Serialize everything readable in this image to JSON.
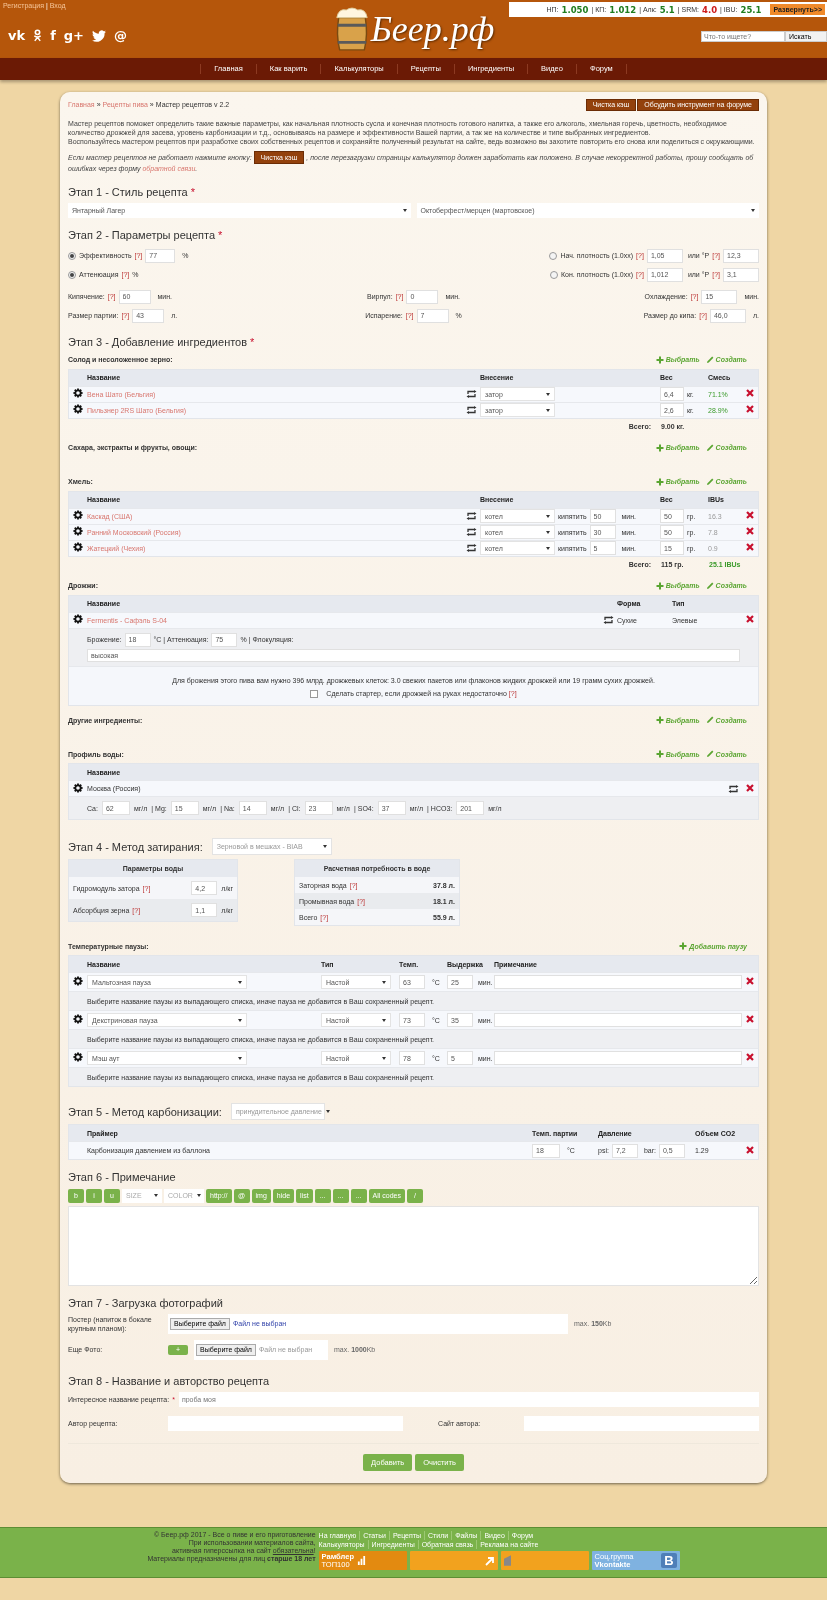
{
  "header": {
    "auth_links": [
      {
        "label": "Регистрация",
        "separator": "|"
      },
      {
        "label": "Вход"
      }
    ],
    "social": [
      {
        "kind": "text",
        "glyph": "vk"
      },
      {
        "kind": "ok"
      },
      {
        "kind": "text",
        "glyph": "f"
      },
      {
        "kind": "text",
        "glyph": "g+"
      },
      {
        "kind": "twitter"
      },
      {
        "kind": "text",
        "glyph": "@"
      }
    ],
    "logo": "Беер.рф",
    "stats": [
      {
        "label": "НП:",
        "value": "1.050",
        "color": "#1e7d1e"
      },
      {
        "label": "| КП:",
        "value": "1.012",
        "color": "#1e7d1e"
      },
      {
        "label": "| Алк:",
        "value": "5.1",
        "color": "#1e7d1e"
      },
      {
        "label": "| SRM:",
        "value": "4.0",
        "color": "#cc1a1a"
      },
      {
        "label": "| IBU:",
        "value": "25.1",
        "color": "#1e7d1e"
      }
    ],
    "expand_button": "Развернуть>>",
    "search": {
      "placeholder": "Что-то ищете?",
      "button": "Искать"
    }
  },
  "nav": [
    "Главная",
    "Как варить",
    "Калькуляторы",
    "Рецепты",
    "Ингредиенты",
    "Видео",
    "Форум"
  ],
  "breadcrumbs": [
    {
      "label": "Главная",
      "separator": "»"
    },
    {
      "label": "Рецепты пива",
      "separator": "»"
    },
    {
      "label": "Мастер рецептов v 2.2"
    }
  ],
  "top_buttons": [
    "Чистка кэш",
    "Обсудить инструмент на форуме"
  ],
  "intro": [
    "Мастер рецептов поможет определить такие важные параметры, как начальная плотность сусла и конечная плотность готового напитка, а также его алкоголь, хмельная горечь, цветность, необходимое количество дрожжей для засева, уровень карбонизации и т.д., основываясь на размере и эффективности Вашей партии, а так же на количестве и типе выбранных ингредиентов.",
    "Воспользуйтесь мастером рецептов при разработке своих собственных рецептов и сохраняйте полученный результат на сайте, ведь возможно вы захотите повторить его снова или поделиться с окружающими."
  ],
  "note": {
    "before": "Если мастер рецептов не работает нажмите кнопку:",
    "button": "Чистка кэш",
    "after": ", после перезагрузки страницы калькулятор должен заработать как положено. В случае некорректной работы, прошу сообщать об ошибках через форму",
    "link": "обратной связи",
    "end": "."
  },
  "stage1": {
    "title": "Этап 1 - Стиль рецепта",
    "required": "*",
    "selects": [
      "Янтарный Лагер",
      "Октоберфест/мерцен (мартовское)"
    ]
  },
  "stage2": {
    "title": "Этап 2 - Параметры рецепта",
    "required": "*",
    "radio_rows": [
      {
        "left": {
          "selected": true,
          "label": "Эффективность",
          "help": "[?]",
          "value": "77",
          "unit": "%"
        },
        "right": {
          "selected": false,
          "label": "Нач. плотность (1.0xx)",
          "help": "[?]",
          "value": "1,05",
          "alt_label": "или °P",
          "alt_help": "[?]",
          "alt_value": "12,3"
        }
      },
      {
        "left": {
          "selected": true,
          "label": "Аттенюация",
          "help": "[?]",
          "unit": "%"
        },
        "right": {
          "selected": false,
          "label": "Кон. плотность (1.0xx)",
          "help": "[?]",
          "value": "1,012",
          "alt_label": "или °P",
          "alt_help": "[?]",
          "alt_value": "3,1"
        }
      }
    ],
    "param_rows": [
      [
        {
          "label": "Кипячение:",
          "help": "[?]",
          "value": "60",
          "unit": "мин."
        },
        {
          "label": "Вирпул:",
          "help": "[?]",
          "value": "0",
          "unit": "мин."
        },
        {
          "label": "Охлаждение:",
          "help": "[?]",
          "value": "15",
          "unit": "мин."
        }
      ],
      [
        {
          "label": "Размер партии:",
          "help": "[?]",
          "value": "43",
          "unit": "л."
        },
        {
          "label": "Испарение:",
          "help": "[?]",
          "value": "7",
          "unit": "%"
        },
        {
          "label": "Размер до кипа:",
          "help": "[?]",
          "value": "46,0",
          "unit": "л."
        }
      ]
    ]
  },
  "stage3": {
    "title": "Этап 3 - Добавление ингредиентов",
    "required": "*",
    "groups": [
      {
        "kind": "grain",
        "title": "Солод и несоложенное зерно:",
        "actions": [
          {
            "kind": "add",
            "label": "Выбрать"
          },
          {
            "kind": "create",
            "label": "Создать"
          }
        ],
        "columns": [
          "Название",
          "Внесение",
          "Вес",
          "Смесь"
        ],
        "rows": [
          {
            "name": "Вена Шато (Бельгия)",
            "addition": "затор",
            "weight": "6,4",
            "unit": "кг.",
            "share": "71.1%"
          },
          {
            "name": "Пильзнер 2RS Шато (Бельгия)",
            "addition": "затор",
            "weight": "2,6",
            "unit": "кг.",
            "share": "28.9%"
          }
        ],
        "total": {
          "label": "Всего:",
          "weight": "9.00 кг."
        }
      },
      {
        "kind": "plain",
        "title": "Сахара, экстракты и фрукты, овощи:",
        "actions": [
          {
            "kind": "add",
            "label": "Выбрать"
          },
          {
            "kind": "create",
            "label": "Создать"
          }
        ]
      },
      {
        "kind": "hop",
        "title": "Хмель:",
        "actions": [
          {
            "kind": "add",
            "label": "Выбрать"
          },
          {
            "kind": "create",
            "label": "Создать"
          }
        ],
        "columns": [
          "Название",
          "Внесение",
          "Вес",
          "IBUs"
        ],
        "rows": [
          {
            "name": "Каскад (США)",
            "addition": "котел",
            "boil_label": "кипятить",
            "boil_time": "50",
            "boil_unit": "мин.",
            "weight": "50",
            "unit": "гр.",
            "ibu": "16.3"
          },
          {
            "name": "Ранний Московский (Россия)",
            "addition": "котел",
            "boil_label": "кипятить",
            "boil_time": "30",
            "boil_unit": "мин.",
            "weight": "50",
            "unit": "гр.",
            "ibu": "7.8"
          },
          {
            "name": "Жатецкий (Чехия)",
            "addition": "котел",
            "boil_label": "кипятить",
            "boil_time": "5",
            "boil_unit": "мин.",
            "weight": "15",
            "unit": "гр.",
            "ibu": "0.9"
          }
        ],
        "total": {
          "label": "Всего:",
          "weight": "115 гр.",
          "ibu": "25.1 IBUs"
        }
      },
      {
        "kind": "yeast",
        "title": "Дрожжи:",
        "actions": [
          {
            "kind": "add",
            "label": "Выбрать"
          },
          {
            "kind": "create",
            "label": "Создать"
          }
        ],
        "columns": [
          "Название",
          "Форма",
          "Тип"
        ],
        "rows": [
          {
            "name": "Fermentis - Сафэль S-04",
            "form": "Сухие",
            "type": "Элевые"
          }
        ],
        "details": {
          "ferment_label": "Брожение:",
          "ferment": "18",
          "atten_label": "°C | Аттенюация:",
          "atten": "75",
          "floc_label": "% | Флокуляция:",
          "floc": "высокая"
        },
        "info": "Для брожения этого пива вам нужно 396 млрд. дрожжевых клеток: 3.0 свежих пакетов или флаконов жидких дрожжей или 19 грамм сухих дрожжей.",
        "starter": {
          "checked": false,
          "label": "Сделать стартер, если дрожжей на руках недостаточно",
          "help": "[?]"
        }
      },
      {
        "kind": "plain",
        "title": "Другие ингредиенты:",
        "actions": [
          {
            "kind": "add",
            "label": "Выбрать"
          },
          {
            "kind": "create",
            "label": "Создать"
          }
        ]
      },
      {
        "kind": "water",
        "title": "Профиль воды:",
        "actions": [
          {
            "kind": "add",
            "label": "Выбрать"
          },
          {
            "kind": "create",
            "label": "Создать"
          }
        ],
        "columns": [
          "Название"
        ],
        "rows": [
          {
            "name": "Москва (Россия)"
          }
        ],
        "ions": [
          {
            "label": "Ca:",
            "value": "62",
            "unit": "мг/л"
          },
          {
            "label": "| Mg:",
            "value": "15",
            "unit": "мг/л"
          },
          {
            "label": "| Na:",
            "value": "14",
            "unit": "мг/л"
          },
          {
            "label": "| Cl:",
            "value": "23",
            "unit": "мг/л"
          },
          {
            "label": "| SO4:",
            "value": "37",
            "unit": "мг/л"
          },
          {
            "label": "| HCO3:",
            "value": "201",
            "unit": "мг/л"
          }
        ]
      }
    ]
  },
  "stage4": {
    "title": "Этап 4 - Метод затирания:",
    "method": "Зерновой в мешках - BIAB",
    "water_params": {
      "title": "Параметры воды",
      "rows": [
        {
          "label": "Гидромодуль затора",
          "help": "[?]",
          "value": "4,2",
          "unit": "л/кг"
        },
        {
          "label": "Абсорбция зерна",
          "help": "[?]",
          "value": "1,1",
          "unit": "л/кг"
        }
      ]
    },
    "water_need": {
      "title": "Расчетная потребность в воде",
      "rows": [
        {
          "label": "Заторная вода",
          "help": "[?]",
          "value": "37.8 л."
        },
        {
          "label": "Промывная вода",
          "help": "[?]",
          "value": "18.1 л."
        },
        {
          "label": "Всего",
          "help": "[?]",
          "value": "55.9 л."
        }
      ]
    },
    "pauses": {
      "title": "Температурные паузы:",
      "action": "Добавить паузу",
      "columns": [
        "Название",
        "Тип",
        "Темп.",
        "Выдержка",
        "Примечание"
      ],
      "rows": [
        {
          "name": "Мальтозная пауза",
          "type": "Настой",
          "temp": "63",
          "temp_unit": "°C",
          "time": "25",
          "time_unit": "мин.",
          "hint": "Выберите название паузы из выпадающего списка, иначе пауза не добавится в Ваш сохраненный рецепт."
        },
        {
          "name": "Декстриновая пауза",
          "type": "Настой",
          "temp": "73",
          "temp_unit": "°C",
          "time": "35",
          "time_unit": "мин.",
          "hint": "Выберите название паузы из выпадающего списка, иначе пауза не добавится в Ваш сохраненный рецепт."
        },
        {
          "name": "Мэш аут",
          "type": "Настой",
          "temp": "78",
          "temp_unit": "°C",
          "time": "5",
          "time_unit": "мин.",
          "hint": "Выберите название паузы из выпадающего списка, иначе пауза не добавится в Ваш сохраненный рецепт."
        }
      ]
    }
  },
  "stage5": {
    "title": "Этап 5 - Метод карбонизации:",
    "method": "принудительное давление",
    "columns": [
      "Праймер",
      "Темп. партии",
      "Давление",
      "Объем CO2"
    ],
    "row": {
      "primer": "Карбонизация давлением из баллона",
      "temp": "18",
      "temp_unit": "°C",
      "psi_label": "psi:",
      "psi": "7,2",
      "bar_label": "bar:",
      "bar": "0,5",
      "co2": "1.29"
    }
  },
  "stage6": {
    "title": "Этап 6 - Примечание",
    "toolbar": [
      {
        "kind": "button",
        "label": "b"
      },
      {
        "kind": "button",
        "label": "i"
      },
      {
        "kind": "button",
        "label": "u"
      },
      {
        "kind": "select",
        "label": "SIZE"
      },
      {
        "kind": "select",
        "label": "COLOR"
      },
      {
        "kind": "button",
        "label": "http://"
      },
      {
        "kind": "button",
        "label": "@"
      },
      {
        "kind": "button",
        "label": "img"
      },
      {
        "kind": "button",
        "label": "hide"
      },
      {
        "kind": "button",
        "label": "list"
      },
      {
        "kind": "button",
        "label": "..."
      },
      {
        "kind": "button",
        "label": "..."
      },
      {
        "kind": "button",
        "label": "..."
      },
      {
        "kind": "button",
        "label": "All codes"
      },
      {
        "kind": "button",
        "label": "/"
      }
    ]
  },
  "stage7": {
    "title": "Этап 7 - Загрузка фотографий",
    "poster": {
      "label": "Постер (напиток в бокале крупным планом):",
      "button": "Выберите файл",
      "status": "Файл не выбран",
      "limit": "max. **150**Kb"
    },
    "more": {
      "label": "Еще Фото:",
      "add": "+",
      "button": "Выберите файл",
      "status": "Файл не выбран",
      "limit": "max. **1000**Kb"
    }
  },
  "stage8": {
    "title": "Этап 8 - Название и авторство рецепта",
    "name": {
      "label": "Интересное название рецепта:",
      "required": "*",
      "placeholder": "проба моя"
    },
    "author": {
      "label": "Автор рецепта:"
    },
    "site": {
      "label": "Сайт автора:"
    }
  },
  "actions": [
    "Добавить",
    "Очистить"
  ],
  "footer": {
    "lines": [
      {
        "text": "© Беер.рф 2017 - Все о пиве и его приготовление"
      },
      {
        "text": "При использовании материалов сайта,"
      },
      {
        "text": "активная гиперссылка на сайт ",
        "link": "обязательна",
        "after": "!"
      },
      {
        "text": "Материалы предназначены для лиц **старше 18 лет**"
      }
    ],
    "links": [
      [
        "На главную",
        "Статьи",
        "Рецепты",
        "Стили",
        "Файлы",
        "Видео",
        "Форум"
      ],
      [
        "Калькуляторы",
        "Ингредиенты",
        "Обратная связь",
        "Реклама на сайте"
      ]
    ],
    "rambler": {
      "label": "Рамблер",
      "sub": "ТОП100"
    },
    "vk": {
      "label": "Соц.группа",
      "sub": "Vkontakte",
      "letter": "B"
    }
  }
}
